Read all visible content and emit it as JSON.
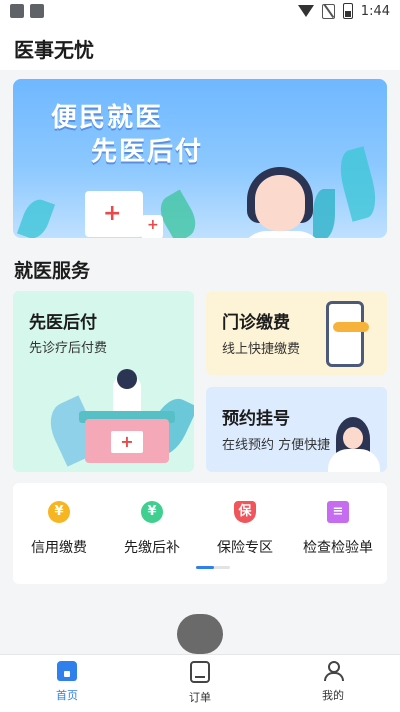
{
  "status_bar": {
    "time": "1:44"
  },
  "app": {
    "title": "医事无忧"
  },
  "banner": {
    "line1": "便民就医",
    "line2": "先医后付"
  },
  "section": {
    "title": "就医服务"
  },
  "services": {
    "pay_later": {
      "title": "先医后付",
      "subtitle": "先诊疗后付费"
    },
    "outpatient": {
      "title": "门诊缴费",
      "subtitle": "线上快捷缴费"
    },
    "appointment": {
      "title": "预约挂号",
      "subtitle": "在线预约 方便快捷"
    }
  },
  "quick_links": [
    {
      "label": "信用缴费",
      "icon": "yen-coin-icon",
      "icon_text": "¥",
      "color": "#f7b521"
    },
    {
      "label": "先缴后补",
      "icon": "yen-refund-icon",
      "icon_text": "¥",
      "color": "#3fcf8e"
    },
    {
      "label": "保险专区",
      "icon": "insurance-shield-icon",
      "icon_text": "保",
      "color": "#f0555b"
    },
    {
      "label": "检查检验单",
      "icon": "report-document-icon",
      "icon_text": "≡",
      "color": "#c56cf0"
    }
  ],
  "tabs": [
    {
      "label": "首页",
      "icon": "home-icon",
      "active": true
    },
    {
      "label": "订单",
      "icon": "order-icon",
      "active": false
    },
    {
      "label": "我的",
      "icon": "profile-icon",
      "active": false
    }
  ],
  "colors": {
    "accent": "#2f80ed"
  }
}
